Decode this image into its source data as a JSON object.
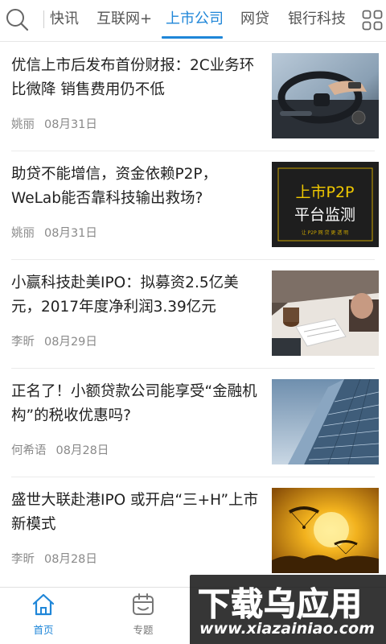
{
  "nav": {
    "tabs": [
      "快讯",
      "互联网+",
      "上市公司",
      "网贷",
      "银行科技"
    ],
    "active_tab": "上市公司",
    "accent_color": "#1f86d8",
    "search_icon": "search-icon",
    "more_icon": "grid-icon"
  },
  "articles": [
    {
      "title": "优信上市后发布首份财报：2C业务环比微降 销售费用仍不低",
      "author": "姚丽",
      "date": "08月31日",
      "thumb": "car-steering-wheel-photo"
    },
    {
      "title": "助贷不能增信，资金依赖P2P，WeLab能否靠科技输出救场?",
      "author": "姚丽",
      "date": "08月31日",
      "thumb": "p2p-monitor-banner",
      "thumb_text": {
        "line1": "上市P2P",
        "line2": "平台监测",
        "sub": "让 P2P 网 贷 更 透 明"
      }
    },
    {
      "title": "小赢科技赴美IPO：拟募资2.5亿美元，2017年度净利润3.39亿元",
      "author": "李昕",
      "date": "08月29日",
      "thumb": "office-desk-photo"
    },
    {
      "title": "正名了！小额贷款公司能享受“金融机构”的税收优惠吗?",
      "author": "何希语",
      "date": "08月28日",
      "thumb": "skyscraper-photo"
    },
    {
      "title": "盛世大联赴港IPO  或开启“三+H”上市新模式",
      "author": "李昕",
      "date": "08月28日",
      "thumb": "paraglider-sunset-photo"
    }
  ],
  "bottom_tabs": [
    {
      "label": "首页",
      "icon": "home-icon",
      "active": true
    },
    {
      "label": "专题",
      "icon": "calendar-icon",
      "active": false
    }
  ],
  "watermark": {
    "text": "下载乌应用",
    "url": "www.xiazainiao.com"
  }
}
